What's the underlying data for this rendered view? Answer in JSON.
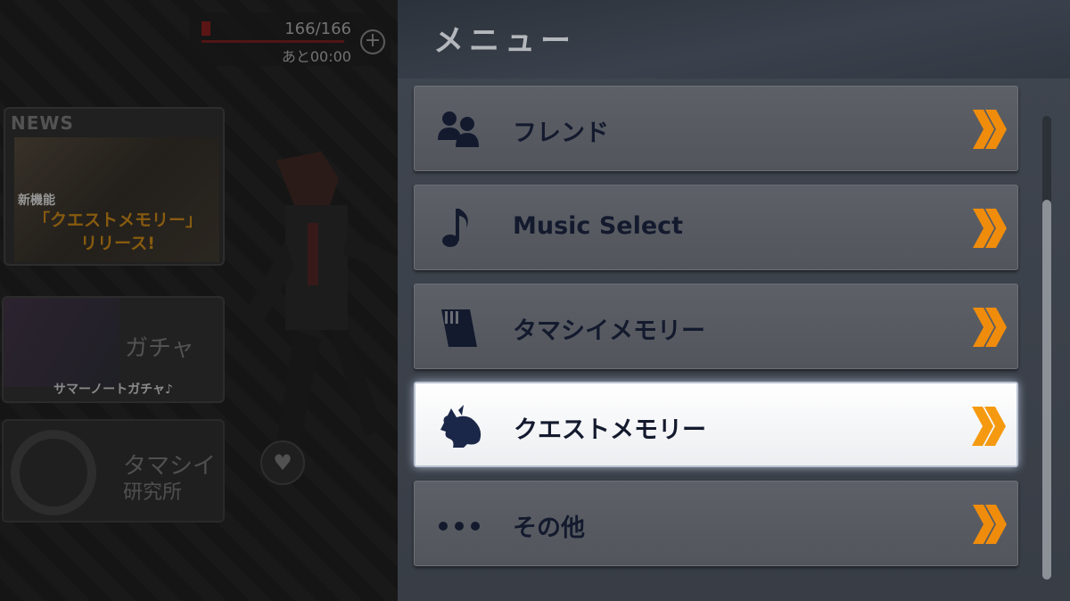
{
  "status": {
    "stamina": "166/166",
    "timer": "あと00:00",
    "add_icon": "plus-circle-icon"
  },
  "background": {
    "news": {
      "label": "NEWS",
      "tag": "新機能",
      "headline_line1": "「クエストメモリー」",
      "headline_line2": "リリース!"
    },
    "gacha": {
      "title": "ガチャ",
      "subtitle": "サマーノートガチャ♪"
    },
    "lab": {
      "title_line1": "タマシイ",
      "title_line2": "研究所"
    },
    "heart_icon": "heart-icon"
  },
  "menu": {
    "title": "メニュー",
    "items": [
      {
        "label": "フレンド",
        "icon": "friends-icon",
        "active": false
      },
      {
        "label": "Music Select",
        "icon": "music-note-icon",
        "active": false
      },
      {
        "label": "タマシイメモリー",
        "icon": "memory-card-icon",
        "active": false
      },
      {
        "label": "クエストメモリー",
        "icon": "character-head-icon",
        "active": true
      },
      {
        "label": "その他",
        "icon": "more-dots-icon",
        "active": false
      }
    ]
  },
  "colors": {
    "accent_orange": "#f08c0c",
    "label_navy": "#141a2e",
    "panel_bg": "#404650"
  }
}
